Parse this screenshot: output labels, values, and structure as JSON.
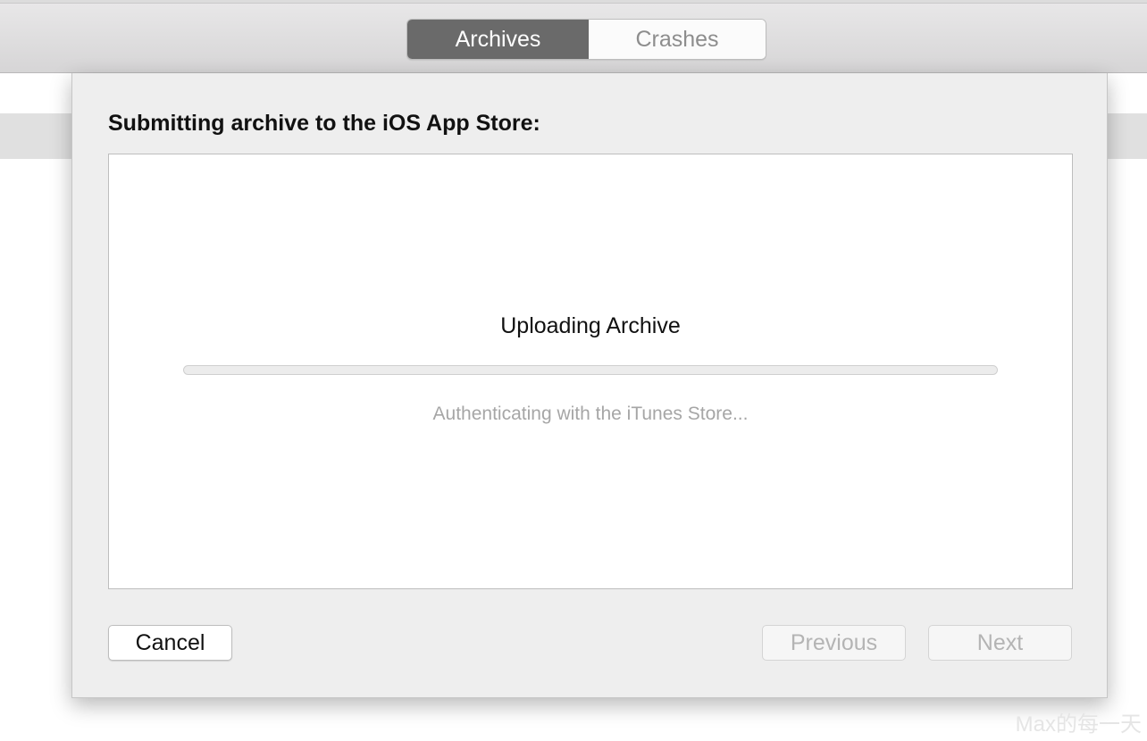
{
  "toolbar": {
    "tabs": [
      {
        "label": "Archives",
        "selected": true
      },
      {
        "label": "Crashes",
        "selected": false
      }
    ]
  },
  "sheet": {
    "title": "Submitting archive to the iOS App Store:",
    "status_title": "Uploading Archive",
    "progress_fraction": 0,
    "status_detail": "Authenticating with the iTunes Store...",
    "buttons": {
      "cancel": "Cancel",
      "previous": "Previous",
      "next": "Next"
    }
  },
  "watermark": "Max的每一天",
  "colors": {
    "selected_tab": "#6a6a6a",
    "sheet_background": "#eeeeee",
    "disabled_text": "#b4b4b4",
    "secondary_text": "#a6a6a6"
  }
}
